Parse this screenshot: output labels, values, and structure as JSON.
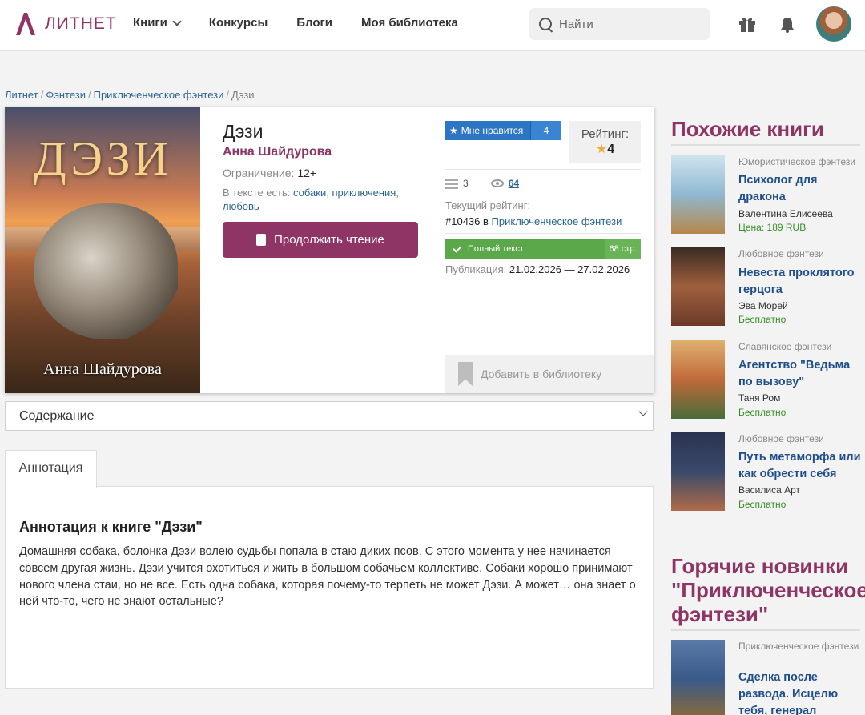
{
  "header": {
    "logo": "ЛИТНЕТ",
    "nav": [
      "Книги",
      "Конкурсы",
      "Блоги",
      "Моя библиотека"
    ],
    "search_placeholder": "Найти",
    "accent": "#8e3566"
  },
  "breadcrumb": [
    "Литнет",
    "Фэнтези",
    "Приключенческое фэнтези",
    "Дэзи"
  ],
  "book": {
    "cover_title": "ДЭЗИ",
    "cover_author": "Анна Шайдурова",
    "title": "Дэзи",
    "author": "Анна Шайдурова",
    "restriction_label": "Ограничение:",
    "restriction_value": "12+",
    "tags_label": "В тексте есть:",
    "tags": [
      "собаки",
      "приключения",
      "любовь"
    ],
    "read_button": "Продолжить чтение",
    "like_label": "Мне нравится",
    "like_count": "4",
    "rating_label": "Рейтинг:",
    "rating_value": "4",
    "libraries_count": "3",
    "views": "64",
    "current_rating_label": "Текущий рейтинг:",
    "current_rating_pos": "#10436",
    "current_rating_in": "в",
    "current_rating_genre": "Приключенческое фэнтези",
    "full_text": "Полный текст",
    "pages": "68 стр.",
    "pub_label": "Публикация:",
    "pub_dates": "21.02.2026 — 27.02.2026",
    "add_library": "Добавить в библиотеку"
  },
  "contents_select": "Содержание",
  "tabs": {
    "annotation": "Аннотация"
  },
  "annotation": {
    "title": "Аннотация к книге \"Дэзи\"",
    "text": "Домашняя собака, болонка Дэзи волею судьбы попала в стаю диких псов. С этого момента у нее начинается совсем другая жизнь. Дэзи учится охотиться и жить в большом собачьем коллективе. Собаки хорошо принимают нового члена стаи, но не все. Есть одна собака, которая почему-то терпеть не может Дэзи. А может… она знает о ней что-то, чего не знают остальные?"
  },
  "sidebar": {
    "similar_title": "Похожие книги",
    "similar": [
      {
        "genre": "Юмористическое фэнтези",
        "title": "Психолог для дракона",
        "author": "Валентина Елисеева",
        "price": "Цена: 189 RUB",
        "cover_color": "#8fb8d0"
      },
      {
        "genre": "Любовное фэнтези",
        "title": "Невеста проклятого герцога",
        "author": "Эва Морей",
        "price": "Бесплатно",
        "cover_color": "#6b3a2a"
      },
      {
        "genre": "Славянское фэнтези",
        "title": "Агентство \"Ведьма по вызову\"",
        "author": "Таня Ром",
        "price": "Бесплатно",
        "cover_color": "#c06a3a"
      },
      {
        "genre": "Любовное фэнтези",
        "title": "Путь метаморфа или как обрести себя",
        "author": "Василиса Арт",
        "price": "Бесплатно",
        "cover_color": "#3a4a6b"
      }
    ],
    "hot_title": "Горячие новинки \"Приключенческое фэнтези\"",
    "hot_title_lines": [
      "Горячие новинки",
      "\"Приключенческое",
      "фэнтези\""
    ],
    "hot": [
      {
        "genre": "Приключенческое фэнтези",
        "title": "Сделка после развода. Исцелю тебя, генерал",
        "cover_color": "#3a5a8a"
      }
    ]
  }
}
